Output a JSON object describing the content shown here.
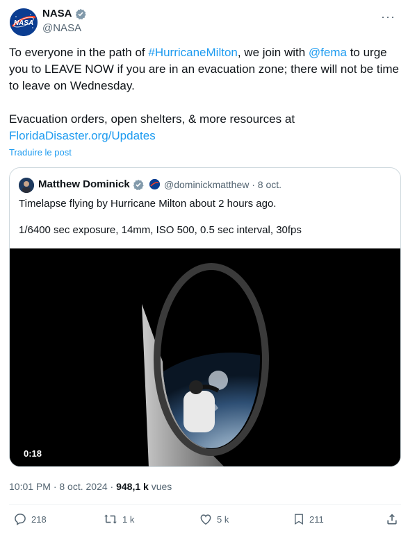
{
  "author": {
    "name": "NASA",
    "handle": "@NASA",
    "avatar_icon": "nasa-logo-icon",
    "logo_text": "NASA"
  },
  "tweet": {
    "line1_prefix": "To everyone in the path of ",
    "hashtag": "#HurricaneMilton",
    "line1_mid": ", we join with ",
    "mention": "@fema",
    "line1_suffix": " to urge you to LEAVE NOW if you are in an evacuation zone; there will not be time to leave on Wednesday.",
    "para2": "Evacuation orders, open shelters, & more resources at",
    "link": "FloridaDisaster.org/Updates",
    "translate_label": "Traduire le post"
  },
  "quote": {
    "name": "Matthew Dominick",
    "handle_date": "@dominickmatthew · 8 oct.",
    "line1": "Timelapse flying by Hurricane Milton about 2 hours ago.",
    "line2": "1/6400 sec exposure, 14mm, ISO 500, 0.5 sec interval, 30fps",
    "video_duration": "0:18"
  },
  "meta": {
    "time_date": "10:01 PM · 8 oct. 2024 · ",
    "views_count": "948,1 k",
    "views_label": " vues"
  },
  "actions": {
    "replies": "218",
    "reposts": "1 k",
    "likes": "5 k",
    "bookmarks": "211"
  },
  "colors": {
    "accent": "#1d9bf0",
    "secondary_text": "#536471",
    "border": "#cfd9de"
  }
}
